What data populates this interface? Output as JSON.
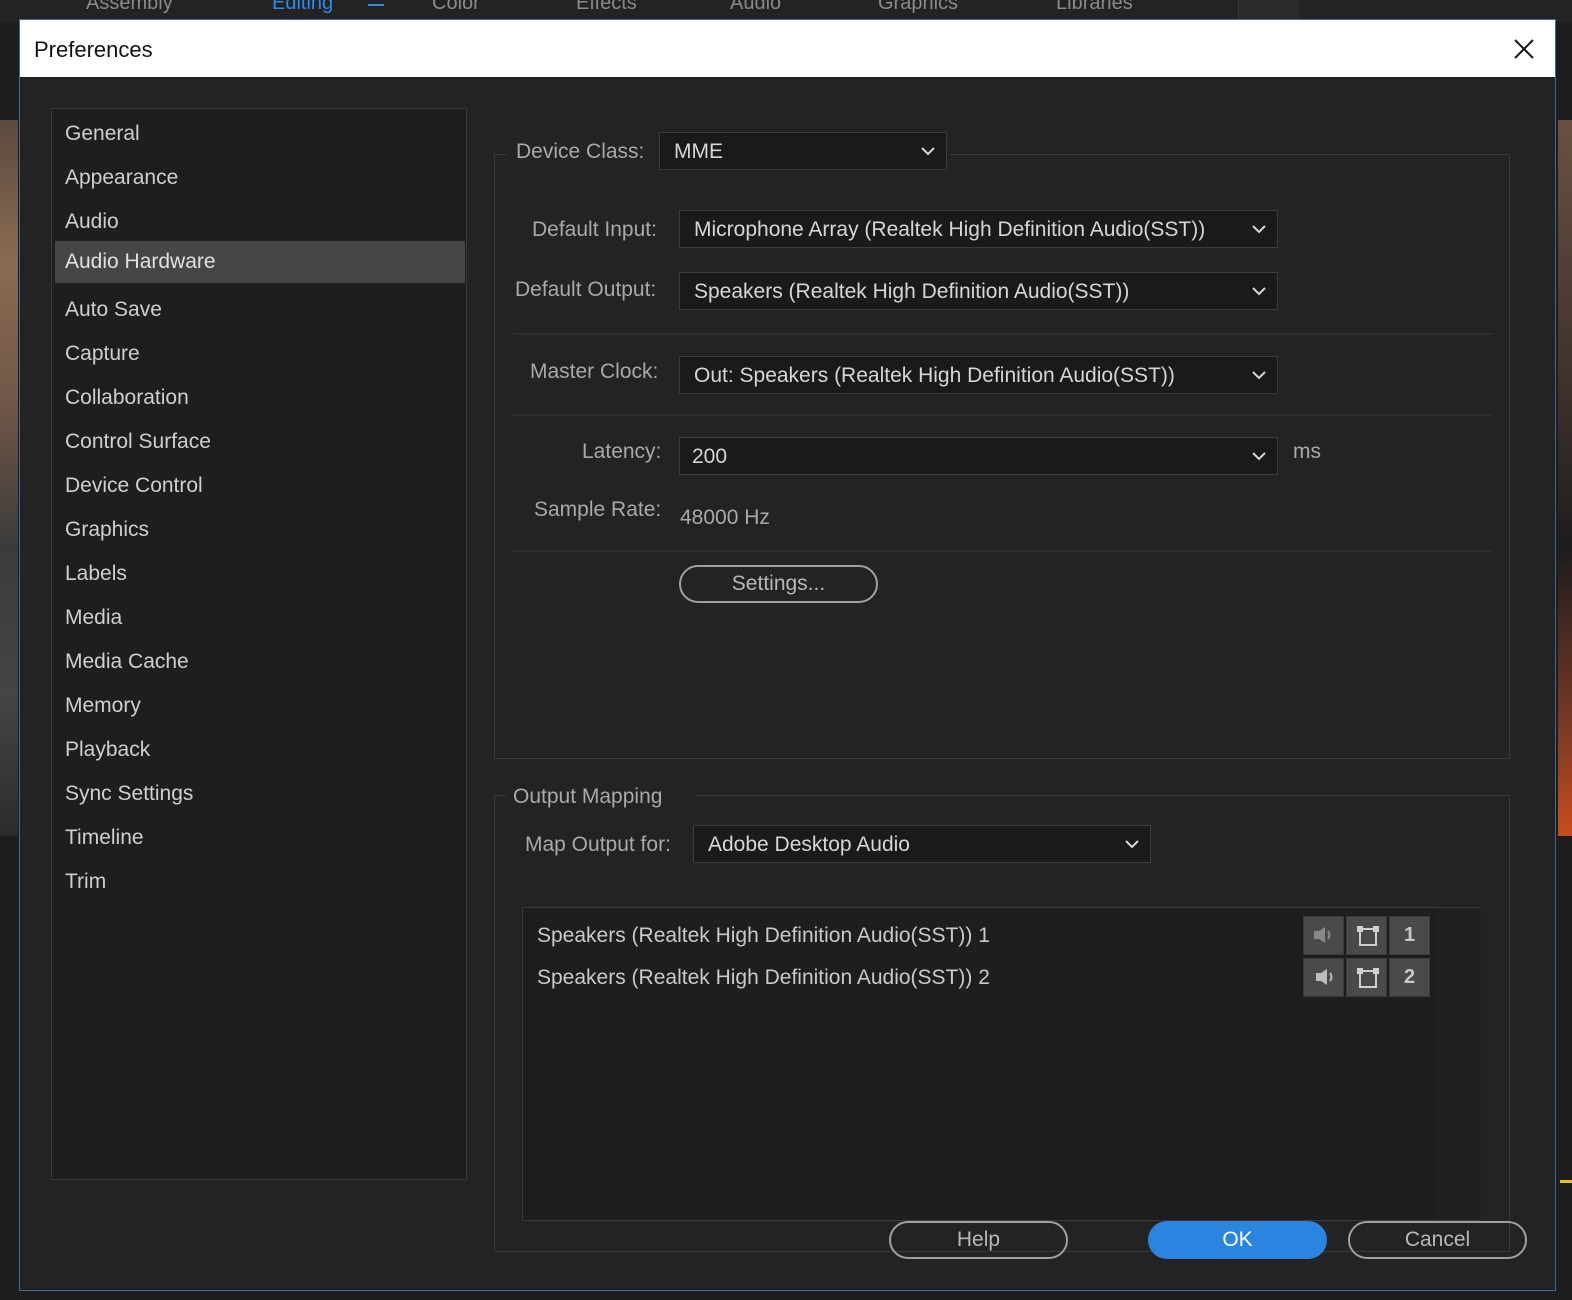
{
  "background": {
    "tabs": [
      "Assembly",
      "Editing",
      "Color",
      "Effects",
      "Audio",
      "Graphics",
      "Libraries"
    ],
    "active_tab": "Editing"
  },
  "dialog": {
    "title": "Preferences",
    "close_icon": "close-icon"
  },
  "categories": [
    {
      "label": "General",
      "selected": false
    },
    {
      "label": "Appearance",
      "selected": false
    },
    {
      "label": "Audio",
      "selected": false
    },
    {
      "label": "Audio Hardware",
      "selected": true
    },
    {
      "label": "Auto Save",
      "selected": false
    },
    {
      "label": "Capture",
      "selected": false
    },
    {
      "label": "Collaboration",
      "selected": false
    },
    {
      "label": "Control Surface",
      "selected": false
    },
    {
      "label": "Device Control",
      "selected": false
    },
    {
      "label": "Graphics",
      "selected": false
    },
    {
      "label": "Labels",
      "selected": false
    },
    {
      "label": "Media",
      "selected": false
    },
    {
      "label": "Media Cache",
      "selected": false
    },
    {
      "label": "Memory",
      "selected": false
    },
    {
      "label": "Playback",
      "selected": false
    },
    {
      "label": "Sync Settings",
      "selected": false
    },
    {
      "label": "Timeline",
      "selected": false
    },
    {
      "label": "Trim",
      "selected": false
    }
  ],
  "hardware": {
    "device_class_label": "Device Class:",
    "device_class_value": "MME",
    "default_input_label": "Default Input:",
    "default_input_value": "Microphone Array (Realtek High Definition Audio(SST))",
    "default_output_label": "Default Output:",
    "default_output_value": "Speakers (Realtek High Definition Audio(SST))",
    "master_clock_label": "Master Clock:",
    "master_clock_value": "Out: Speakers (Realtek High Definition Audio(SST))",
    "latency_label": "Latency:",
    "latency_value": "200",
    "latency_unit": "ms",
    "sample_rate_label": "Sample Rate:",
    "sample_rate_value": "48000 Hz",
    "settings_button": "Settings..."
  },
  "output_mapping": {
    "legend": "Output Mapping",
    "map_output_for_label": "Map Output for:",
    "map_output_for_value": "Adobe Desktop Audio",
    "rows": [
      {
        "label": "Speakers (Realtek High Definition Audio(SST)) 1",
        "channel": "1"
      },
      {
        "label": "Speakers (Realtek High Definition Audio(SST)) 2",
        "channel": "2"
      }
    ]
  },
  "footer": {
    "help": "Help",
    "ok": "OK",
    "cancel": "Cancel"
  },
  "colors": {
    "accent": "#2a84e0",
    "selected_item": "#464646",
    "dialog_bg": "#232323"
  }
}
